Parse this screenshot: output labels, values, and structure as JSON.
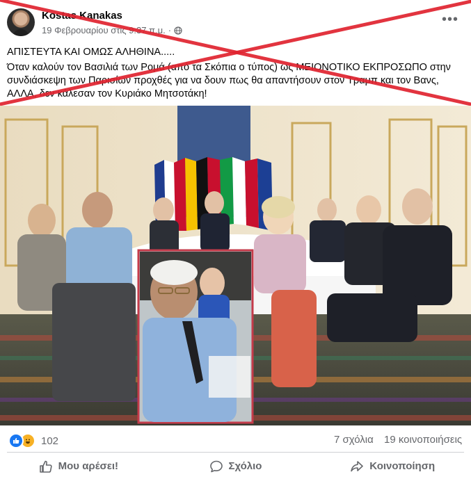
{
  "post": {
    "author": "Kostas Kanakas",
    "date": "19 Φεβρουαρίου στις 9:37 π.μ.",
    "more_label": "•••",
    "text_line1": "ΑΠΙΣΤΕΥΤΑ ΚΑΙ ΟΜΩΣ ΑΛΗΘΙΝΑ.....",
    "text_line2": "Όταν καλούν τον Βασιλιά των Ρομά (από τα Σκόπια ο τύπος) ως ΜΕΙΟΝΟΤΙΚΟ ΕΚΠΡΟΣΩΠΟ στην συνδιάσκεψη των Παρισίων προχθές για να δουν πως θα απαντήσουν στον Τραμπ και τον Βανς, ΑΛΛΑ, δεν κάλεσαν τον Κυριάκο Μητσοτάκη!"
  },
  "stats": {
    "reaction_count": "102",
    "comments": "7 σχόλια",
    "shares": "19 κοινοποιήσεις"
  },
  "actions": {
    "like": "Μου αρέσει!",
    "comment": "Σχόλιο",
    "share": "Κοινοποίηση"
  },
  "icons": [
    "globe-icon",
    "like-reaction-icon",
    "haha-reaction-icon",
    "like-icon",
    "comment-icon",
    "share-icon"
  ],
  "colors": {
    "brand_blue": "#1877f2",
    "x_mark_red": "#e0232f",
    "secondary_text": "#65676b"
  }
}
